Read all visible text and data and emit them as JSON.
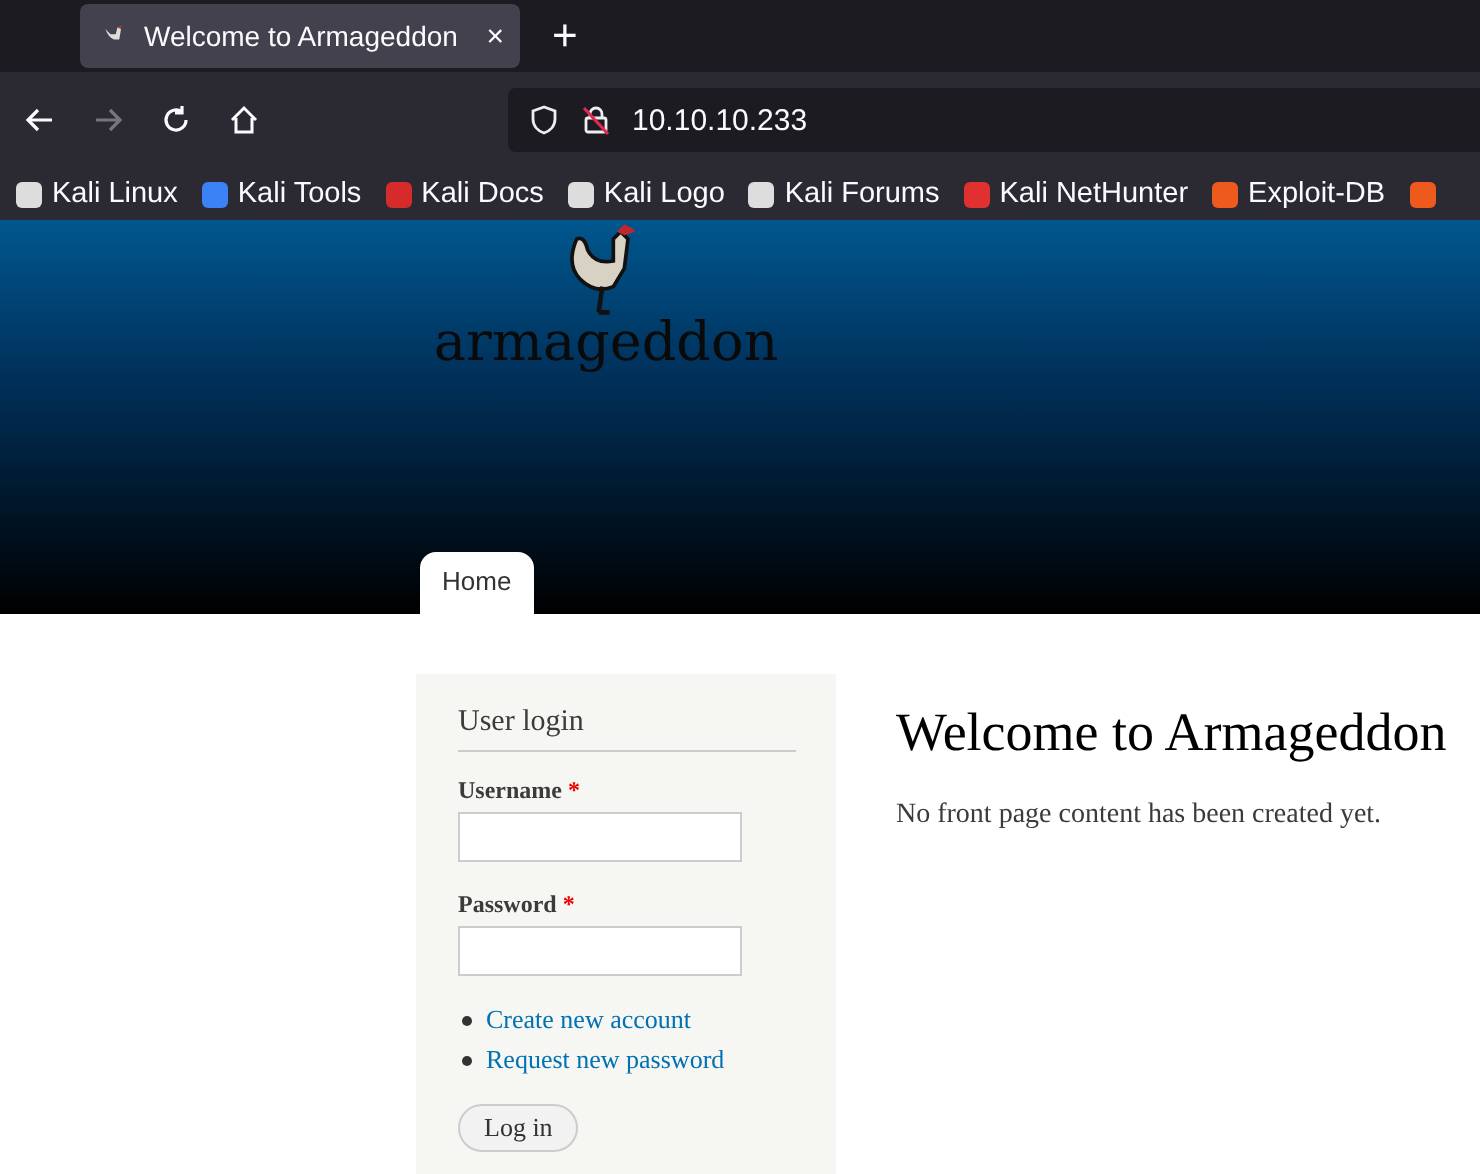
{
  "browser": {
    "tab": {
      "title": "Welcome to Armageddon",
      "close": "×",
      "selected": true
    },
    "new_tab": "+",
    "nav": {
      "back_disabled": false,
      "forward_disabled": true
    },
    "url": "10.10.10.233",
    "bookmarks": [
      {
        "label": "Kali Linux",
        "color": "#dddddd"
      },
      {
        "label": "Kali Tools",
        "color": "#3b82f6"
      },
      {
        "label": "Kali Docs",
        "color": "#d52b2b"
      },
      {
        "label": "Kali Logo",
        "color": "#dddddd"
      },
      {
        "label": "Kali Forums",
        "color": "#dddddd"
      },
      {
        "label": "Kali NetHunter",
        "color": "#e03030"
      },
      {
        "label": "Exploit-DB",
        "color": "#ee5a1e"
      },
      {
        "color": "#ee5a1e"
      }
    ]
  },
  "site": {
    "name": "armageddon",
    "menu": [
      {
        "label": "Home",
        "selected": true
      }
    ]
  },
  "login": {
    "title": "User login",
    "fields": [
      {
        "label": "Username",
        "required_mark": "*"
      },
      {
        "label": "Password",
        "required_mark": "*"
      }
    ],
    "links": [
      "Create new account",
      "Request new password"
    ],
    "button": "Log in"
  },
  "content": {
    "heading": "Welcome to Armageddon",
    "text": "No front page content has been created yet."
  }
}
